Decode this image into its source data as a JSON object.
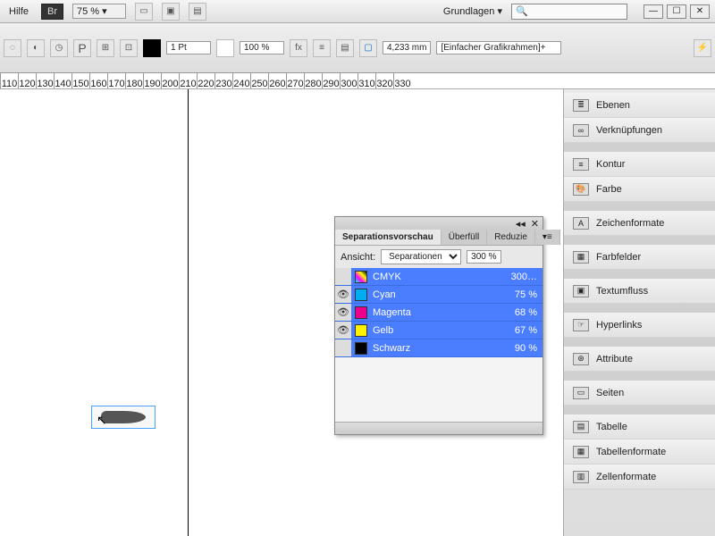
{
  "topbar": {
    "help": "Hilfe",
    "br": "Br",
    "zoom": "75 %",
    "workspace": "Grundlagen"
  },
  "toolbar": {
    "stroke": "1 Pt",
    "scale": "100 %",
    "frame_w": "4,233 mm",
    "frame_type": "[Einfacher Grafikrahmen]+"
  },
  "ruler": [
    "110",
    "120",
    "130",
    "140",
    "150",
    "160",
    "170",
    "180",
    "190",
    "200",
    "210",
    "220",
    "230",
    "240",
    "250",
    "260",
    "270",
    "280",
    "290",
    "300",
    "310",
    "320",
    "330"
  ],
  "panels": [
    {
      "label": "Ebenen",
      "icon": "≣"
    },
    {
      "label": "Verknüpfungen",
      "icon": "∞"
    },
    {
      "gap": true
    },
    {
      "label": "Kontur",
      "icon": "≡"
    },
    {
      "label": "Farbe",
      "icon": "🎨"
    },
    {
      "gap": true
    },
    {
      "label": "Zeichenformate",
      "icon": "A"
    },
    {
      "gap": true
    },
    {
      "label": "Farbfelder",
      "icon": "▦"
    },
    {
      "gap": true
    },
    {
      "label": "Textumfluss",
      "icon": "▣"
    },
    {
      "gap": true
    },
    {
      "label": "Hyperlinks",
      "icon": "☞"
    },
    {
      "gap": true
    },
    {
      "label": "Attribute",
      "icon": "⊛"
    },
    {
      "gap": true
    },
    {
      "label": "Seiten",
      "icon": "▭"
    },
    {
      "gap": true
    },
    {
      "label": "Tabelle",
      "icon": "▤"
    },
    {
      "label": "Tabellenformate",
      "icon": "▦"
    },
    {
      "label": "Zellenformate",
      "icon": "▥"
    }
  ],
  "sep_panel": {
    "tabs": [
      "Separationsvorschau",
      "Überfüll",
      "Reduzie"
    ],
    "view_label": "Ansicht:",
    "view_value": "Separationen",
    "pct": "300 %",
    "rows": [
      {
        "name": "CMYK",
        "val": "300…",
        "swatch": "linear-gradient(45deg,#0ff,#f0f,#ff0,#000)",
        "eye": ""
      },
      {
        "name": "Cyan",
        "val": "75 %",
        "swatch": "#00aeef",
        "eye": "👁"
      },
      {
        "name": "Magenta",
        "val": "68 %",
        "swatch": "#ec008c",
        "eye": "👁"
      },
      {
        "name": "Gelb",
        "val": "67 %",
        "swatch": "#fff200",
        "eye": "👁"
      },
      {
        "name": "Schwarz",
        "val": "90 %",
        "swatch": "#000",
        "eye": ""
      }
    ]
  }
}
